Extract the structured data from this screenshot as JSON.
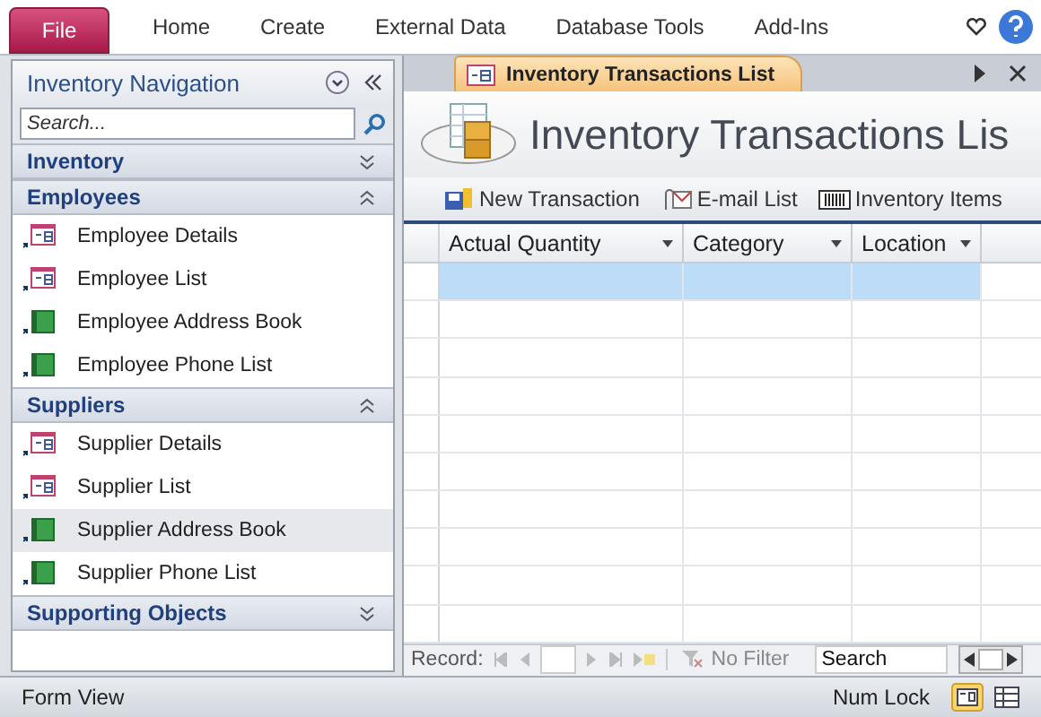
{
  "ribbon": {
    "file_tab": "File",
    "tabs": [
      "Home",
      "Create",
      "External Data",
      "Database Tools",
      "Add-Ins"
    ]
  },
  "navigation": {
    "title": "Inventory Navigation",
    "search": {
      "placeholder": "Search..."
    },
    "groups": [
      {
        "label": "Inventory",
        "expanded": false
      },
      {
        "label": "Employees",
        "expanded": true,
        "items": [
          {
            "label": "Employee Details",
            "kind": "form",
            "selected": false
          },
          {
            "label": "Employee List",
            "kind": "form",
            "selected": false
          },
          {
            "label": "Employee Address Book",
            "kind": "report",
            "selected": false
          },
          {
            "label": "Employee Phone List",
            "kind": "report",
            "selected": false
          }
        ]
      },
      {
        "label": "Suppliers",
        "expanded": true,
        "items": [
          {
            "label": "Supplier Details",
            "kind": "form",
            "selected": false
          },
          {
            "label": "Supplier List",
            "kind": "form",
            "selected": false
          },
          {
            "label": "Supplier Address Book",
            "kind": "report",
            "selected": true
          },
          {
            "label": "Supplier Phone List",
            "kind": "report",
            "selected": false
          }
        ]
      },
      {
        "label": "Supporting Objects",
        "expanded": false
      }
    ]
  },
  "document_tab": {
    "label": "Inventory Transactions List"
  },
  "form": {
    "title": "Inventory Transactions Lis",
    "actions": [
      {
        "label": "New Transaction",
        "kind": "new"
      },
      {
        "label": "E-mail List",
        "kind": "email"
      },
      {
        "label": "Inventory Items",
        "kind": "items"
      }
    ],
    "columns": [
      "Actual Quantity",
      "Category",
      "Location"
    ]
  },
  "record_bar": {
    "label": "Record:",
    "filter": "No Filter",
    "search": "Search"
  },
  "status_bar": {
    "view": "Form View",
    "num_lock": "Num Lock"
  }
}
